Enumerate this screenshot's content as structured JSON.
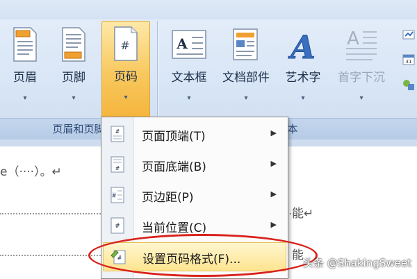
{
  "ribbon": {
    "buttons": [
      {
        "label": "页眉",
        "icon": "header-page-icon",
        "caret": "▾"
      },
      {
        "label": "页脚",
        "icon": "footer-page-icon",
        "caret": "▾"
      },
      {
        "label": "页码",
        "icon": "page-number-icon",
        "caret": "▾"
      },
      {
        "label": "文本框",
        "icon": "textbox-icon",
        "caret": "▾"
      },
      {
        "label": "文档部件",
        "icon": "quick-parts-icon",
        "caret": "▾"
      },
      {
        "label": "艺术字",
        "icon": "wordart-icon",
        "caret": "▾"
      },
      {
        "label": "首字下沉",
        "icon": "drop-cap-icon",
        "caret": "▾"
      }
    ],
    "groups": {
      "header_footer": "页眉和页脚",
      "text": "文本"
    }
  },
  "menu": {
    "items": [
      {
        "label": "页面顶端(T)",
        "arrow": "▶",
        "icon": "page-top-icon"
      },
      {
        "label": "页面底端(B)",
        "arrow": "▶",
        "icon": "page-bottom-icon"
      },
      {
        "label": "页边距(P)",
        "arrow": "▶",
        "icon": "page-margin-icon"
      },
      {
        "label": "当前位置(C)",
        "arrow": "▶",
        "icon": "current-position-icon"
      },
      {
        "label": "设置页码格式(F)...",
        "arrow": "",
        "icon": "format-page-number-icon"
      }
    ]
  },
  "document": {
    "line1": "e（····）。↵",
    "fragment_a": "能↵",
    "fragment_b": "能"
  },
  "watermark": "头条 @ShakingSweet",
  "colors": {
    "ribbon_bg": "#d9e6f6",
    "active_button": "#f8c85e",
    "highlight_item": "#fde48f",
    "annotation_ellipse": "#d9221c"
  }
}
